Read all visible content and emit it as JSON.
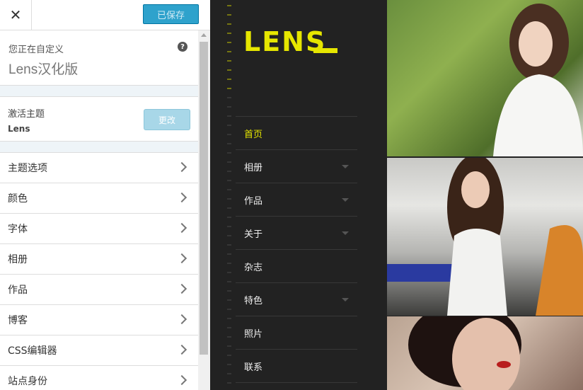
{
  "customizer": {
    "close_symbol": "✕",
    "save_label": "已保存",
    "info": {
      "label": "您正在自定义",
      "title": "Lens汉化版",
      "help_symbol": "?"
    },
    "active_theme": {
      "label": "激活主题",
      "name": "Lens",
      "change_label": "更改"
    },
    "sections": [
      {
        "label": "主题选项"
      },
      {
        "label": "颜色"
      },
      {
        "label": "字体"
      },
      {
        "label": "相册"
      },
      {
        "label": "作品"
      },
      {
        "label": "博客"
      },
      {
        "label": "CSS编辑器"
      },
      {
        "label": "站点身份"
      }
    ]
  },
  "preview": {
    "logo": "LENS",
    "nav": [
      {
        "label": "首页",
        "active": true,
        "has_submenu": false
      },
      {
        "label": "相册",
        "active": false,
        "has_submenu": true
      },
      {
        "label": "作品",
        "active": false,
        "has_submenu": true
      },
      {
        "label": "关于",
        "active": false,
        "has_submenu": true
      },
      {
        "label": "杂志",
        "active": false,
        "has_submenu": false
      },
      {
        "label": "特色",
        "active": false,
        "has_submenu": true
      },
      {
        "label": "照片",
        "active": false,
        "has_submenu": false
      },
      {
        "label": "联系",
        "active": false,
        "has_submenu": false
      }
    ]
  },
  "colors": {
    "accent_yellow": "#e6e600",
    "save_blue": "#2ea2cc",
    "preview_bg": "#222222"
  },
  "icons": {
    "close": "close-icon",
    "help": "help-icon",
    "chevron": "chevron-right-icon",
    "submenu": "caret-down-icon"
  }
}
